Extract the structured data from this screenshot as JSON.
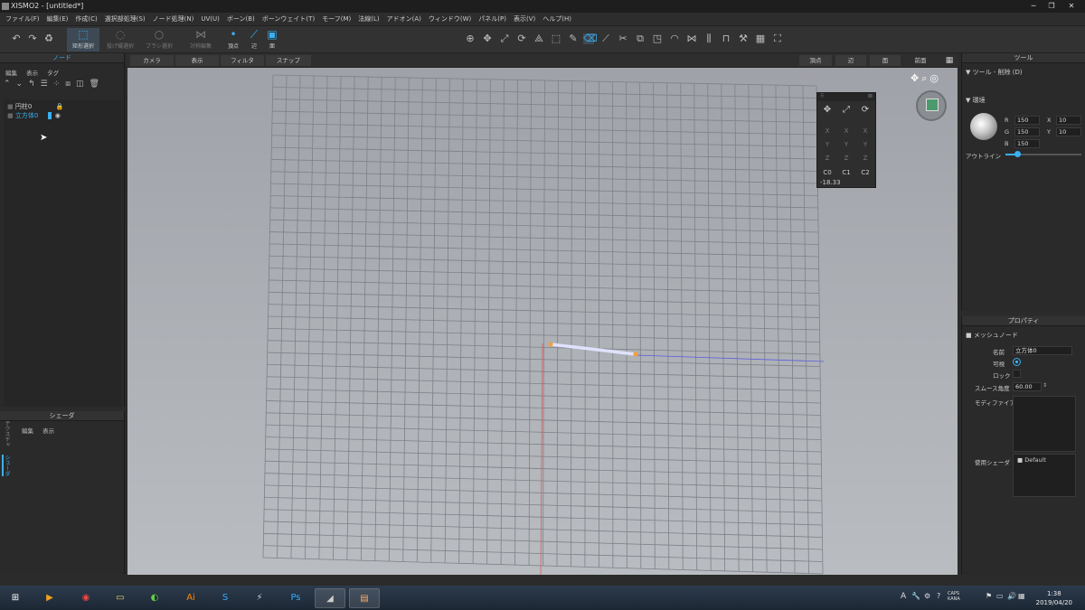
{
  "window": {
    "title": "XISMO2 - [untitled*]"
  },
  "menu": [
    "ファイル(F)",
    "編集(E)",
    "作成(C)",
    "選択部処理(S)",
    "ノード処理(N)",
    "UV(U)",
    "ボーン(B)",
    "ボーンウェイト(T)",
    "モーフ(M)",
    "法線(L)",
    "アドオン(A)",
    "ウィンドウ(W)",
    "パネル(P)",
    "表示(V)",
    "ヘルプ(H)"
  ],
  "toolbar": {
    "rect_select": "矩形選択",
    "lasso_select": "投げ縄選択",
    "brush_select": "ブラシ選択",
    "symmetric_edit": "対称編集",
    "vertex": "頂点",
    "edge": "辺",
    "face": "面"
  },
  "node_panel": {
    "title": "ノード",
    "menu": [
      "編集",
      "表示",
      "タグ"
    ],
    "nodes": [
      {
        "name": "円柱0",
        "locked": true
      },
      {
        "name": "立方体0",
        "active": true,
        "visible": true
      }
    ]
  },
  "shader_panel": {
    "title": "シェーダ",
    "menu": [
      "編集",
      "表示"
    ],
    "side_tabs": [
      "テクスチャ",
      "シェーダ"
    ]
  },
  "viewport_bar": {
    "camera": "カメラ",
    "display": "表示",
    "filter": "フィルタ",
    "snap": "スナップ",
    "vertex": "頂点",
    "edge": "辺",
    "face": "面",
    "view_name": "前面"
  },
  "gizmo": {
    "rows": [
      [
        "X",
        "X",
        "X"
      ],
      [
        "Y",
        "Y",
        "Y"
      ],
      [
        "Z",
        "Z",
        "Z"
      ]
    ],
    "c_labels": [
      "C0",
      "C1",
      "C2"
    ],
    "value": "-18.33"
  },
  "tool_panel": {
    "title": "ツール",
    "header": "ツール - 削除 (D)",
    "section": "環境",
    "rgb": [
      {
        "k": "R",
        "v": "150"
      },
      {
        "k": "G",
        "v": "150"
      },
      {
        "k": "B",
        "v": "150"
      }
    ],
    "xy": [
      {
        "k": "X",
        "v": "10"
      },
      {
        "k": "Y",
        "v": "10"
      }
    ],
    "outline": "アウトライン",
    "outline_level": 0.15
  },
  "property_panel": {
    "title": "プロパティ",
    "section": "メッシュノード",
    "name_label": "名前",
    "name_value": "立方体0",
    "visible_label": "可視",
    "lock_label": "ロック",
    "smooth_label": "スムース角度",
    "smooth_value": "60.00",
    "modifier_label": "モディファイア",
    "shader_label": "使用シェーダ",
    "shader_value": "Default"
  },
  "taskbar": {
    "time": "1:38",
    "date": "2019/04/20",
    "ime": "A",
    "cap": "CAPS KANA"
  },
  "colors": {
    "accent": "#3ab0f0",
    "selected_edge": "#e0e2ff",
    "vertex": "#f0a040"
  }
}
